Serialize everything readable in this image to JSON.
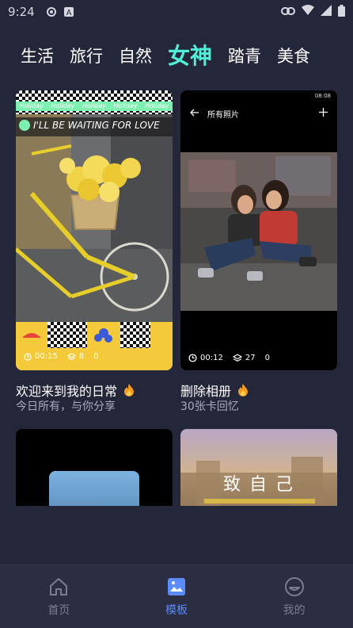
{
  "status_bar": {
    "time": "9:24"
  },
  "tabs": [
    {
      "label": "生活"
    },
    {
      "label": "旅行"
    },
    {
      "label": "自然"
    },
    {
      "label": "女神"
    },
    {
      "label": "踏青"
    },
    {
      "label": "美食"
    }
  ],
  "cards": [
    {
      "banner": [
        "Holiday",
        "Holiday",
        "Holiday",
        "Holiday",
        "Holiday"
      ],
      "overlay_text": "I'LL BE WAITING FOR LOVE",
      "stats": {
        "duration": "00:15",
        "layers": "8",
        "likes": "0"
      },
      "title": "欢迎来到我的日常",
      "subtitle": "今日所有，与你分享"
    },
    {
      "mini_status_time": "08:08",
      "album_title": "所有照片",
      "stats": {
        "duration": "00:12",
        "layers": "27",
        "likes": "0"
      },
      "title": "删除相册",
      "subtitle": "30张卡回忆"
    },
    {},
    {
      "overlay_text": "致 自 己"
    }
  ],
  "bottom_nav": [
    {
      "label": "首页"
    },
    {
      "label": "模板"
    },
    {
      "label": "我的"
    }
  ],
  "colors": {
    "accent_tab": "#4ff0d8",
    "accent_nav": "#5a8bff",
    "background": "#24263a"
  }
}
